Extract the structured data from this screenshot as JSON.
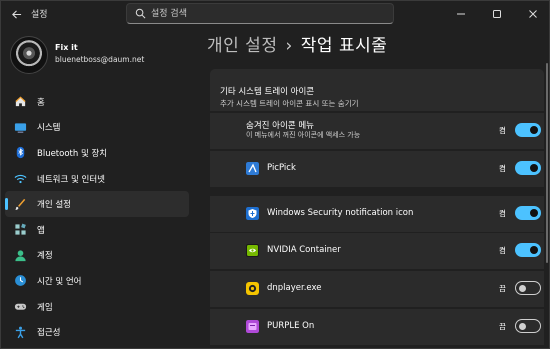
{
  "app": {
    "title": "설정"
  },
  "search": {
    "placeholder": "설정 검색"
  },
  "user": {
    "name": "Fix it",
    "email": "bluenetboss@daum.net"
  },
  "sidebar": {
    "items": [
      {
        "label": "홈",
        "icon": "home-icon",
        "active": false
      },
      {
        "label": "시스템",
        "icon": "system-icon",
        "active": false
      },
      {
        "label": "Bluetooth 및 장치",
        "icon": "bluetooth-icon",
        "active": false
      },
      {
        "label": "네트워크 및 인터넷",
        "icon": "network-icon",
        "active": false
      },
      {
        "label": "개인 설정",
        "icon": "personalization-icon",
        "active": true
      },
      {
        "label": "앱",
        "icon": "apps-icon",
        "active": false
      },
      {
        "label": "계정",
        "icon": "account-icon",
        "active": false
      },
      {
        "label": "시간 및 언어",
        "icon": "time-language-icon",
        "active": false
      },
      {
        "label": "게임",
        "icon": "gaming-icon",
        "active": false
      },
      {
        "label": "접근성",
        "icon": "accessibility-icon",
        "active": false
      }
    ]
  },
  "header": {
    "parent": "개인 설정",
    "separator": "›",
    "current": "작업 표시줄"
  },
  "section": {
    "title": "기타 시스템 트레이 아이콘",
    "subtitle": "추가 시스템 트레이 아이콘 표시 또는 숨기기"
  },
  "rows": [
    {
      "label": "숨겨진 아이콘 메뉴",
      "sub": "이 메뉴에서 꺼진 아이콘에 액세스 가능",
      "state": "켬",
      "on": true,
      "icon": ""
    },
    {
      "label": "PicPick",
      "state": "켬",
      "on": true,
      "icon": "picpick-icon"
    },
    {
      "label": "Windows Security notification icon",
      "state": "켬",
      "on": true,
      "icon": "windows-security-icon"
    },
    {
      "label": "NVIDIA Container",
      "state": "켬",
      "on": true,
      "icon": "nvidia-icon"
    },
    {
      "label": "dnplayer.exe",
      "state": "끔",
      "on": false,
      "icon": "dnplayer-icon"
    },
    {
      "label": "PURPLE On",
      "state": "끔",
      "on": false,
      "icon": "purple-icon"
    }
  ],
  "colors": {
    "accent": "#4cc2ff",
    "background": "#202020",
    "card": "#2b2b2b"
  }
}
